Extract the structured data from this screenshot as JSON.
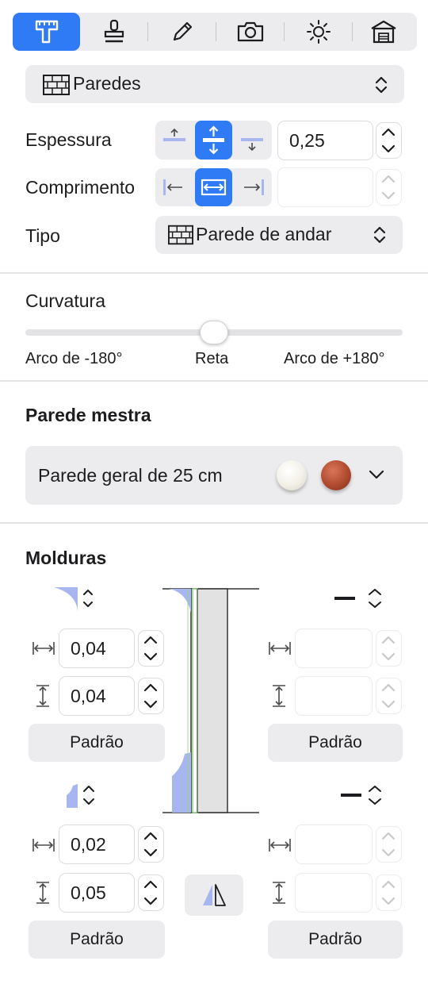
{
  "toolbar": {
    "tabs": [
      {
        "name": "measure-tab",
        "icon": "caliper-icon",
        "active": true
      },
      {
        "name": "paint-tab",
        "icon": "stamp-icon",
        "active": false
      },
      {
        "name": "edit-tab",
        "icon": "pencil-icon",
        "active": false
      },
      {
        "name": "camera-tab",
        "icon": "camera-icon",
        "active": false
      },
      {
        "name": "light-tab",
        "icon": "sun-icon",
        "active": false
      },
      {
        "name": "building-tab",
        "icon": "house-icon",
        "active": false
      }
    ]
  },
  "category": {
    "label": "Paredes",
    "icon": "brick-wall-icon"
  },
  "thickness": {
    "label": "Espessura",
    "value": "0,25",
    "options": [
      "align-top",
      "align-center",
      "align-bottom"
    ],
    "selected": "align-center"
  },
  "length": {
    "label": "Comprimento",
    "value": "",
    "options": [
      "align-left",
      "align-center",
      "align-right"
    ],
    "selected": "align-center"
  },
  "type": {
    "label": "Tipo",
    "value": "Parede de andar",
    "icon": "brick-wall-icon"
  },
  "curvature": {
    "label": "Curvatura",
    "min_label": "Arco de -180°",
    "mid_label": "Reta",
    "max_label": "Arco de +180°",
    "value_fraction": 0.5
  },
  "master_wall": {
    "heading": "Parede mestra",
    "value": "Parede geral de 25 cm",
    "colors": [
      "#f2f0e6",
      "#b04a2e"
    ]
  },
  "moldings": {
    "heading": "Molduras",
    "top_left": {
      "width": "0,04",
      "height": "0,04",
      "button": "Padrão"
    },
    "top_right": {
      "width": "",
      "height": "",
      "button": "Padrão"
    },
    "bottom_left": {
      "width": "0,02",
      "height": "0,05",
      "button": "Padrão"
    },
    "bottom_right": {
      "width": "",
      "height": "",
      "button": "Padrão"
    },
    "accent_color": "#a7b6ee",
    "wall_color": "#e2e2e2",
    "green_color": "#8fd67f"
  }
}
